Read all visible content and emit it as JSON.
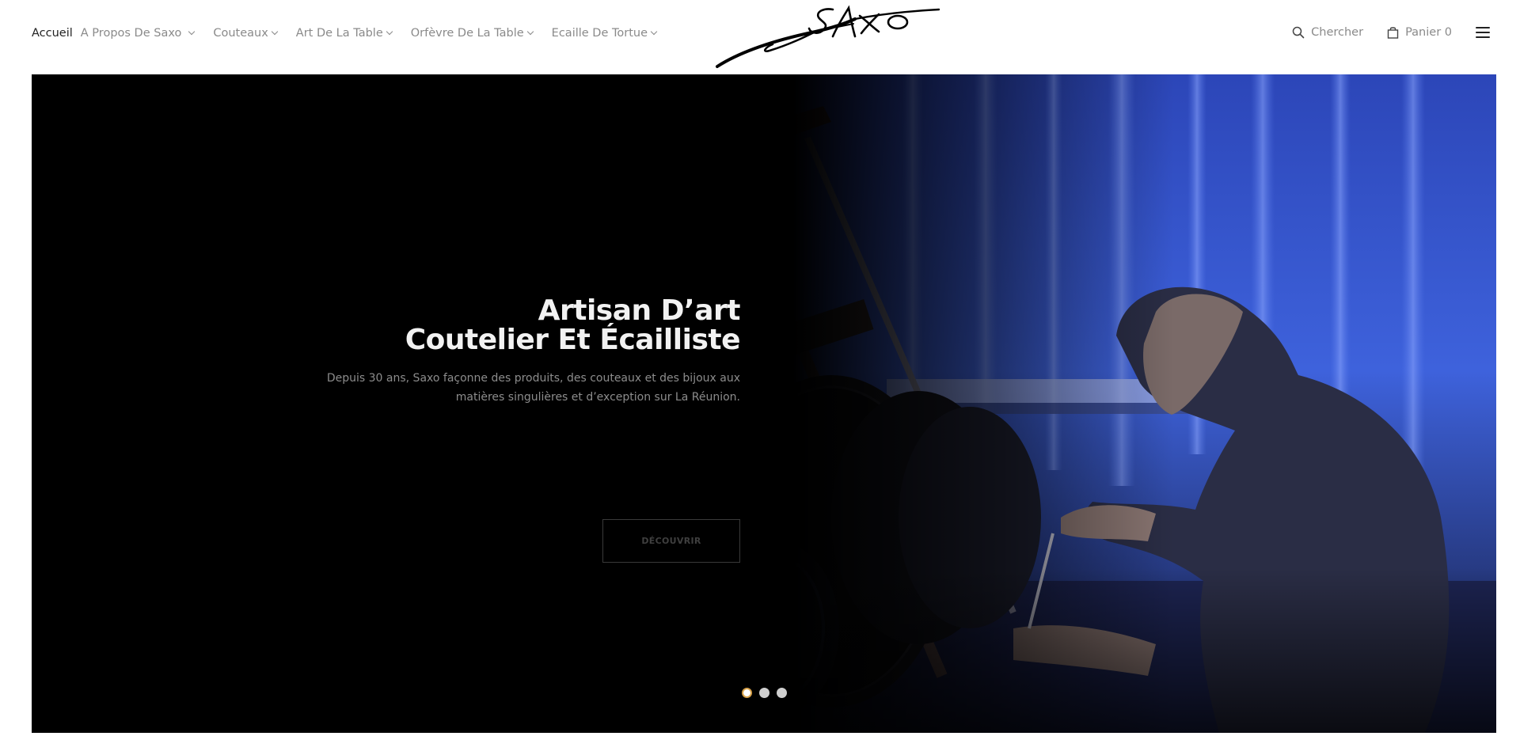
{
  "nav": {
    "items": [
      {
        "label": "Accueil",
        "active": true,
        "dropdown": false
      },
      {
        "label": "A Propos De Saxo",
        "active": false,
        "dropdown": true
      },
      {
        "label": "Couteaux",
        "active": false,
        "dropdown": true
      },
      {
        "label": "Art De La Table",
        "active": false,
        "dropdown": true
      },
      {
        "label": "Orfèvre De La Table",
        "active": false,
        "dropdown": true
      },
      {
        "label": "Ecaille De Tortue",
        "active": false,
        "dropdown": true
      }
    ]
  },
  "logo": {
    "alt": "Saxo"
  },
  "tools": {
    "search_label": "Chercher",
    "cart_label": "Panier 0",
    "search_icon": "search-icon",
    "cart_icon": "shopping-bag-icon",
    "menu_icon": "hamburger-menu-icon"
  },
  "hero": {
    "title_line1": "Artisan D’art",
    "title_line2": "Coutelier Et Écailliste",
    "desc_line1": "Depuis 30 ans, Saxo façonne des produits, des couteaux et des bijoux aux",
    "desc_line2": "matières singulières et d’exception sur La Réunion.",
    "button_label": "DÉCOUVRIR",
    "slides_total": 3,
    "active_slide": 1
  },
  "colors": {
    "accent": "#d8a24a",
    "hero_bg": "#000000",
    "photo_blue": "#3d5fd6"
  }
}
